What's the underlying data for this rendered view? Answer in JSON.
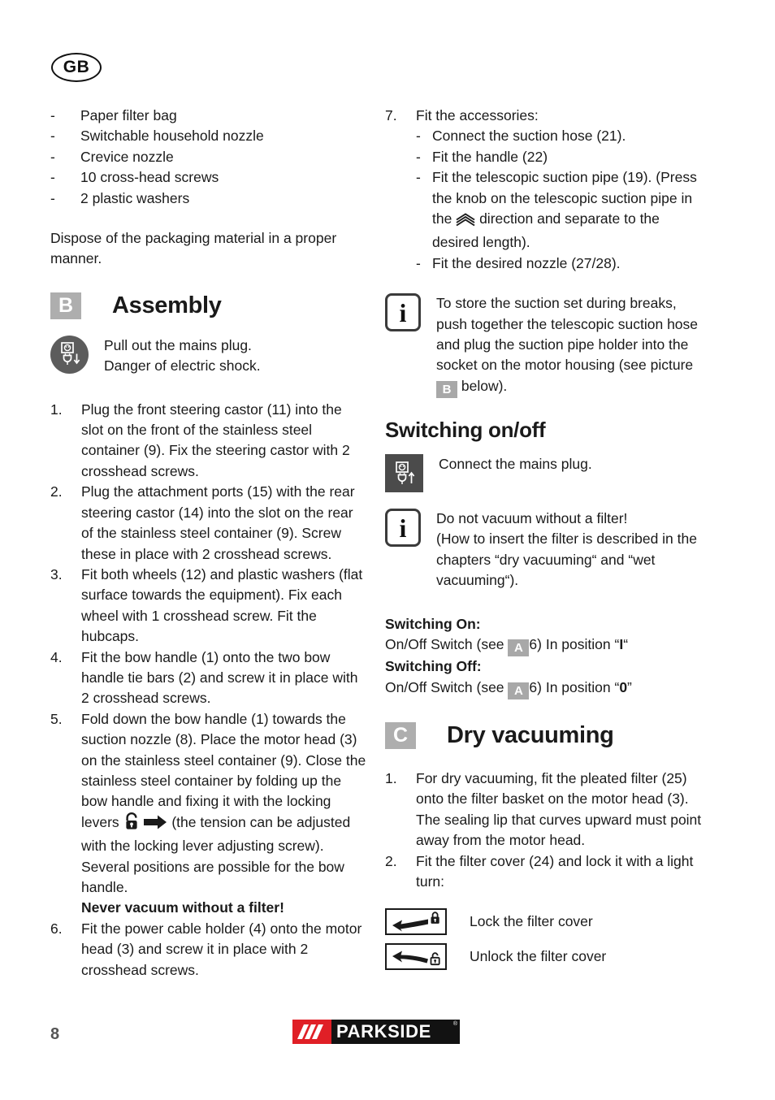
{
  "page": {
    "language_badge": "GB",
    "page_number": "8",
    "logo_text": "PARKSIDE",
    "logo_tm": "®",
    "logo_red_hex": "#e01f26",
    "logo_black_hex": "#121212",
    "badge_gray_hex": "#aeaeae",
    "icon_dark_hex": "#5c5c5c"
  },
  "left_column": {
    "packing_list": [
      {
        "bullet": "-",
        "text": "Paper filter bag"
      },
      {
        "bullet": "-",
        "text": "Switchable household nozzle"
      },
      {
        "bullet": "-",
        "text": "Crevice nozzle"
      },
      {
        "bullet": "-",
        "text": "10 cross-head screws"
      },
      {
        "bullet": "-",
        "text": "2 plastic washers"
      }
    ],
    "dispose_note": "Dispose of the packaging material in a proper manner.",
    "assembly": {
      "badge": "B",
      "title": "Assembly",
      "warning_icon": "mains-plug-pull-out-icon",
      "warning_line1": "Pull out the mains plug.",
      "warning_line2": "Danger of electric shock.",
      "steps": [
        {
          "num": "1.",
          "text": "Plug the front steering castor (11) into the slot on the front of the stainless steel container (9). Fix the steering castor with 2 crosshead screws."
        },
        {
          "num": "2.",
          "text": "Plug the attachment ports (15) with the rear steering castor (14) into the slot on the rear of the stainless steel container (9). Screw these in place with 2 crosshead screws."
        },
        {
          "num": "3.",
          "text": "Fit both wheels (12) and plastic washers (flat surface towards the equipment). Fix each wheel with 1 crosshead screw. Fit the hubcaps."
        },
        {
          "num": "4.",
          "text": "Fit the bow handle (1) onto the two bow handle tie bars (2) and screw it in place with 2 crosshead screws."
        },
        {
          "num": "5.",
          "part1": "Fold down the bow handle (1) towards the suction nozzle (8). Place the motor head (3) on the stainless steel container (9). Close the stainless steel container by folding up the bow handle and fixing it with the locking levers",
          "icon1": "open-padlock-icon",
          "icon2": "right-arrow-icon",
          "part2": "(the tension can be adjusted with the locking lever adjusting screw). Several positions are possible for the bow handle.",
          "bold_warning": "Never vacuum without a filter!"
        },
        {
          "num": "6.",
          "text": "Fit the power cable holder (4) onto the motor head (3) and screw it in place with 2 crosshead screws."
        }
      ]
    }
  },
  "right_column": {
    "step7": {
      "num": "7.",
      "title": "Fit the accessories:",
      "sub_items": [
        {
          "bullet": "-",
          "text": "Connect the suction hose (21)."
        },
        {
          "bullet": "-",
          "text": "Fit the handle (22)"
        },
        {
          "bullet": "-",
          "text_part1": "Fit the telescopic suction pipe (19). (Press the knob on the telescopic suction pipe in the",
          "icon": "triple-chevron-up-icon",
          "text_part2": "direction and separate to the desired length)."
        },
        {
          "bullet": "-",
          "text": "Fit the desired nozzle (27/28)."
        }
      ]
    },
    "info_note_storage": {
      "icon": "info-icon",
      "text_part1": "To store the suction set during breaks, push together the telescopic suction hose and plug the suction pipe holder into the socket on the motor housing (see picture",
      "inline_badge": "B",
      "text_part2": "below)."
    },
    "switching": {
      "title": "Switching on/off",
      "connect_icon": "mains-plug-connect-icon",
      "connect_text": "Connect the mains plug.",
      "info_icon": "info-icon",
      "info_line1": "Do not vacuum without a filter!",
      "info_line2": "(How to insert the filter is described in the chapters “dry vacuuming“ and “wet vacuuming“).",
      "on_label": "Switching On:",
      "on_text_part1": "On/Off Switch (see",
      "on_badge": "A",
      "on_text_part2": "6) In position “",
      "on_position": "I",
      "on_text_part3": "“",
      "off_label": "Switching Off:",
      "off_text_part1": "On/Off Switch (see",
      "off_badge": "A",
      "off_text_part2": "6) In position “",
      "off_position": "0",
      "off_text_part3": "”"
    },
    "dry_vacuuming": {
      "badge": "C",
      "title": "Dry vacuuming",
      "steps": [
        {
          "num": "1.",
          "text": "For dry vacuuming, fit the pleated filter (25) onto the filter basket on the motor head (3). The sealing lip that curves upward must point away from the motor head."
        },
        {
          "num": "2.",
          "text": "Fit the filter cover (24) and lock it with a light turn:"
        }
      ],
      "lock_rows": [
        {
          "icon": "lock-filter-cover-icon",
          "label": "Lock the filter cover"
        },
        {
          "icon": "unlock-filter-cover-icon",
          "label": "Unlock the filter cover"
        }
      ]
    }
  }
}
